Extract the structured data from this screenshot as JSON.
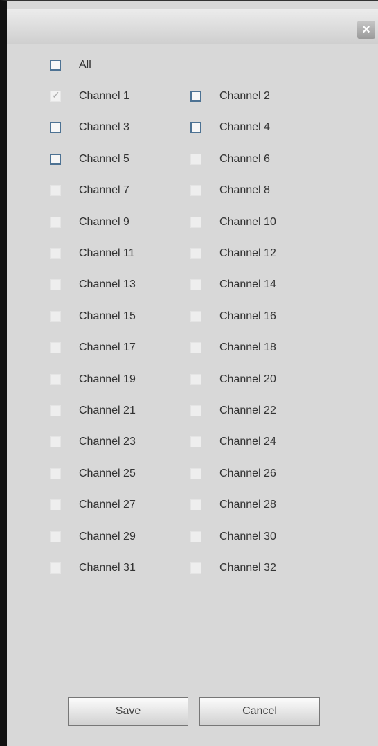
{
  "dialog": {
    "close_symbol": "×"
  },
  "all": {
    "label": "All",
    "checked": false
  },
  "channels": [
    {
      "label": "Channel 1",
      "checked": true,
      "enabled": false
    },
    {
      "label": "Channel 2",
      "checked": false,
      "enabled": true
    },
    {
      "label": "Channel 3",
      "checked": false,
      "enabled": true
    },
    {
      "label": "Channel 4",
      "checked": false,
      "enabled": true
    },
    {
      "label": "Channel 5",
      "checked": false,
      "enabled": true
    },
    {
      "label": "Channel 6",
      "checked": false,
      "enabled": false
    },
    {
      "label": "Channel 7",
      "checked": false,
      "enabled": false
    },
    {
      "label": "Channel 8",
      "checked": false,
      "enabled": false
    },
    {
      "label": "Channel 9",
      "checked": false,
      "enabled": false
    },
    {
      "label": "Channel 10",
      "checked": false,
      "enabled": false
    },
    {
      "label": "Channel 11",
      "checked": false,
      "enabled": false
    },
    {
      "label": "Channel 12",
      "checked": false,
      "enabled": false
    },
    {
      "label": "Channel 13",
      "checked": false,
      "enabled": false
    },
    {
      "label": "Channel 14",
      "checked": false,
      "enabled": false
    },
    {
      "label": "Channel 15",
      "checked": false,
      "enabled": false
    },
    {
      "label": "Channel 16",
      "checked": false,
      "enabled": false
    },
    {
      "label": "Channel 17",
      "checked": false,
      "enabled": false
    },
    {
      "label": "Channel 18",
      "checked": false,
      "enabled": false
    },
    {
      "label": "Channel 19",
      "checked": false,
      "enabled": false
    },
    {
      "label": "Channel 20",
      "checked": false,
      "enabled": false
    },
    {
      "label": "Channel 21",
      "checked": false,
      "enabled": false
    },
    {
      "label": "Channel 22",
      "checked": false,
      "enabled": false
    },
    {
      "label": "Channel 23",
      "checked": false,
      "enabled": false
    },
    {
      "label": "Channel 24",
      "checked": false,
      "enabled": false
    },
    {
      "label": "Channel 25",
      "checked": false,
      "enabled": false
    },
    {
      "label": "Channel 26",
      "checked": false,
      "enabled": false
    },
    {
      "label": "Channel 27",
      "checked": false,
      "enabled": false
    },
    {
      "label": "Channel 28",
      "checked": false,
      "enabled": false
    },
    {
      "label": "Channel 29",
      "checked": false,
      "enabled": false
    },
    {
      "label": "Channel 30",
      "checked": false,
      "enabled": false
    },
    {
      "label": "Channel 31",
      "checked": false,
      "enabled": false
    },
    {
      "label": "Channel 32",
      "checked": false,
      "enabled": false
    }
  ],
  "buttons": {
    "save_label": "Save",
    "cancel_label": "Cancel"
  }
}
